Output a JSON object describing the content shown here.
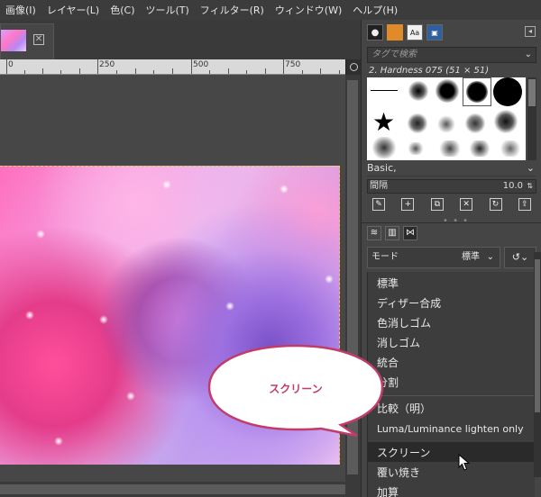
{
  "menubar": {
    "items": [
      "画像(I)",
      "レイヤー(L)",
      "色(C)",
      "ツール(T)",
      "フィルター(R)",
      "ウィンドウ(W)",
      "ヘルプ(H)"
    ]
  },
  "ruler": {
    "labels": [
      "0",
      "250",
      "500",
      "750"
    ]
  },
  "dock": {
    "tag_search_placeholder": "タグで検索",
    "brush_name": "2. Hardness 075 (51 × 51)",
    "preset_label": "Basic,",
    "spacing_label": "間隔",
    "spacing_value": "10.0",
    "mode_label": "モード",
    "mode_value": "標準"
  },
  "mode_menu": {
    "items": [
      "標準",
      "ディザー合成",
      "色消しゴム",
      "消しゴム",
      "統合",
      "分割",
      "比較（明）",
      "Luma/Luminance lighten only",
      "スクリーン",
      "覆い焼き",
      "加算"
    ],
    "highlighted": "スクリーン"
  },
  "callout": {
    "text": "スクリーン"
  },
  "colors": {
    "accent": "#c13c66",
    "selection_border": "#e7d350"
  }
}
